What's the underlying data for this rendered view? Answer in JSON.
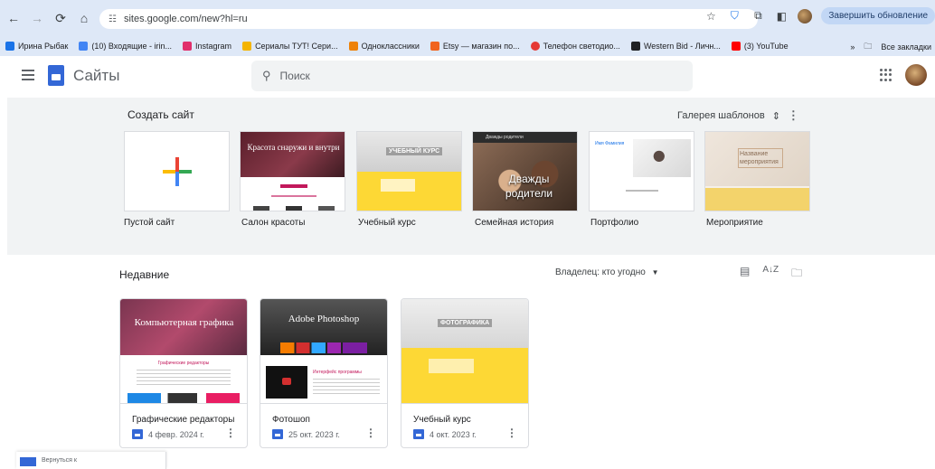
{
  "browser": {
    "url": "sites.google.com/new?hl=ru",
    "update_button": "Завершить обновление",
    "bookmarks": [
      {
        "label": "Ирина Рыбак",
        "color": "#1a73e8"
      },
      {
        "label": "(10) Входящие - irin...",
        "color": "#4285f4"
      },
      {
        "label": "Instagram",
        "color": "#e1306c"
      },
      {
        "label": "Сериалы ТУТ! Сери...",
        "color": "#f4b400"
      },
      {
        "label": "Одноклассники",
        "color": "#ee8208"
      },
      {
        "label": "Etsy — магазин по...",
        "color": "#f1641e"
      },
      {
        "label": "Телефон светодио...",
        "color": "#e53935"
      },
      {
        "label": "Western Bid - Личн...",
        "color": "#202124"
      },
      {
        "label": "(3) YouTube",
        "color": "#ff0000"
      }
    ],
    "more_bookmarks": "»",
    "all_bookmarks": "Все закладки"
  },
  "header": {
    "app_title": "Сайты",
    "search_placeholder": "Поиск"
  },
  "templates": {
    "title": "Создать сайт",
    "gallery_label": "Галерея шаблонов",
    "items": [
      {
        "label": "Пустой сайт"
      },
      {
        "label": "Салон красоты",
        "thumb_text": "Красота снаружи и внутри"
      },
      {
        "label": "Учебный курс",
        "thumb_text": "УЧЕБНЫЙ КУРС"
      },
      {
        "label": "Семейная история",
        "thumb_text": "Дважды родители",
        "thumb_header": "Дважды родители"
      },
      {
        "label": "Портфолио",
        "thumb_text": "Имя Фамилия"
      },
      {
        "label": "Мероприятие",
        "thumb_text": "Название мероприятия"
      }
    ]
  },
  "recent": {
    "title": "Недавние",
    "owner_filter": "Владелец: кто угодно",
    "cards": [
      {
        "name": "Графические редакторы",
        "date": "4 февр. 2024 г.",
        "thumb_text": "Компьютерная графика",
        "thumb_sub": "Графические редакторы"
      },
      {
        "name": "Фотошоп",
        "date": "25 окт. 2023 г.",
        "thumb_text": "Adobe Photoshop",
        "thumb_sub": "Интерфейс программы"
      },
      {
        "name": "Учебный курс",
        "date": "4 окт. 2023 г.",
        "thumb_text": "ФОТОГРАФИКА"
      }
    ]
  },
  "back_bar": {
    "label": "Вернуться к"
  }
}
